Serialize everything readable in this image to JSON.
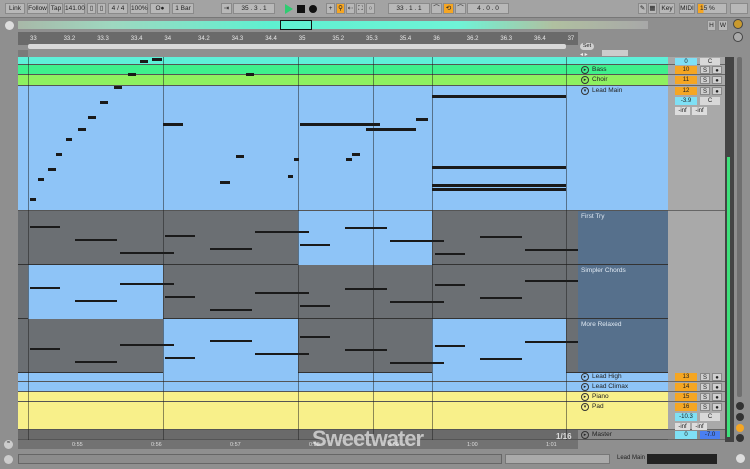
{
  "transport": {
    "link": "Link",
    "follow": "Follow",
    "tap": "Tap",
    "tempo": "141.00",
    "signature": "4 / 4",
    "zoom": "100%",
    "metro": "O●",
    "quantize": "1 Bar",
    "position": "35 .  3 .  1",
    "loop_start": "33 .  1 .  1",
    "loop_length": "4 .  0 .  0",
    "key": "Key",
    "midi": "MIDI",
    "cpu": "15 %"
  },
  "overview": {
    "h": "H",
    "w": "W"
  },
  "ruler": [
    "33",
    "33.2",
    "33.3",
    "33.4",
    "34",
    "34.2",
    "34.3",
    "34.4",
    "35",
    "35.2",
    "35.3",
    "35.4",
    "36",
    "36.2",
    "36.3",
    "36.4",
    "37"
  ],
  "set_label": "Set",
  "tracks": [
    {
      "name": "",
      "color": "#5ef0d8",
      "num": "0",
      "pan": "C"
    },
    {
      "name": "Bass",
      "color": "#3ff08c",
      "num": "10",
      "s": "S"
    },
    {
      "name": "Choir",
      "color": "#8ef060",
      "num": "11",
      "s": "S"
    },
    {
      "name": "Lead Main",
      "color": "#8ec4f7",
      "num": "12",
      "s": "S",
      "vol": "-3.9",
      "pan": "C",
      "sends": [
        "-inf",
        "-inf"
      ]
    },
    {
      "name": "Lead High",
      "color": "#8ec4f7",
      "num": "13",
      "s": "S"
    },
    {
      "name": "Lead Climax",
      "color": "#8ec4f7",
      "num": "14",
      "s": "S"
    },
    {
      "name": "Piano",
      "color": "#f8f08a",
      "num": "15",
      "s": "S"
    },
    {
      "name": "Pad",
      "color": "#f8f08a",
      "num": "16",
      "s": "S",
      "vol": "-10.3",
      "pan": "C",
      "sends": [
        "-inf",
        "-inf"
      ]
    },
    {
      "name": "Master",
      "color": "#8f8f8f",
      "vol": "0",
      "pan": "-7.0"
    }
  ],
  "takes": [
    "First Try",
    "Simpler Chords",
    "More Relaxed"
  ],
  "time_ruler": [
    "0:55",
    "0:56",
    "0:57",
    "0:58",
    "0:59",
    "1:00",
    "1:01"
  ],
  "grid": "1/16",
  "status": {
    "track": "Lead Main"
  },
  "watermark": "Sweetwater",
  "colors": {
    "accent": "#f5a623",
    "play": "#2ecc71",
    "lead": "#8ec4f7",
    "take_bg": "#6b6f73"
  }
}
